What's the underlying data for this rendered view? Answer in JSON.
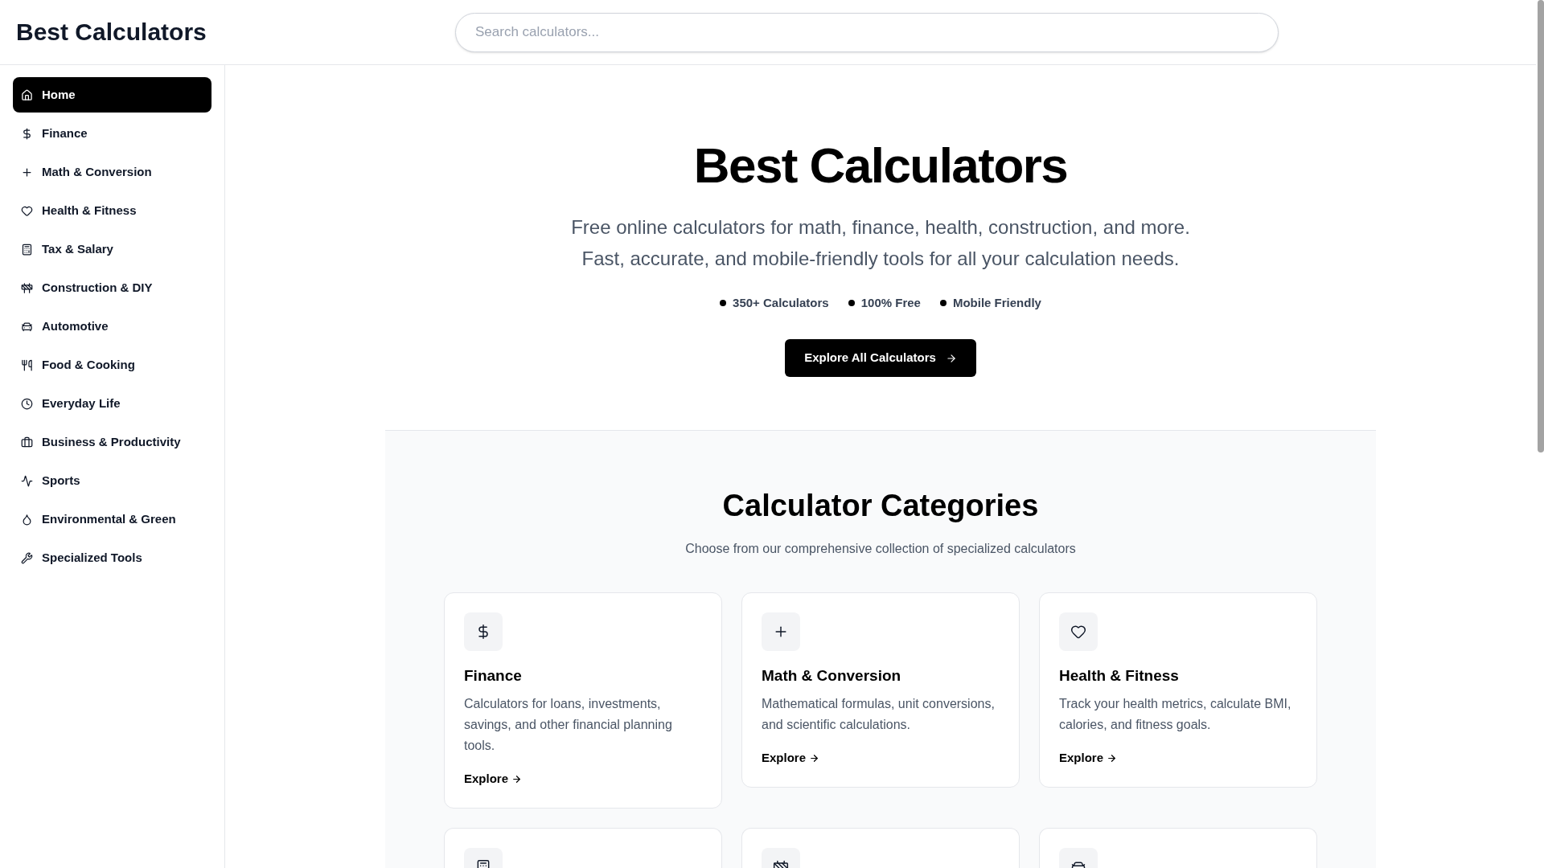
{
  "header": {
    "logo": "Best Calculators",
    "search": {
      "placeholder": "Search calculators..."
    }
  },
  "sidebar": {
    "items": [
      {
        "label": "Home",
        "selected": true
      },
      {
        "label": "Finance",
        "selected": false
      },
      {
        "label": "Math & Conversion",
        "selected": false
      },
      {
        "label": "Health & Fitness",
        "selected": false
      },
      {
        "label": "Tax & Salary",
        "selected": false
      },
      {
        "label": "Construction & DIY",
        "selected": false
      },
      {
        "label": "Automotive",
        "selected": false
      },
      {
        "label": "Food & Cooking",
        "selected": false
      },
      {
        "label": "Everyday Life",
        "selected": false
      },
      {
        "label": "Business & Productivity",
        "selected": false
      },
      {
        "label": "Sports",
        "selected": false
      },
      {
        "label": "Environmental & Green",
        "selected": false
      },
      {
        "label": "Specialized Tools",
        "selected": false
      }
    ]
  },
  "hero": {
    "title": "Best Calculators",
    "subtitle": "Free online calculators for math, finance, health, construction, and more. Fast, accurate, and mobile-friendly tools for all your calculation needs.",
    "highlights": [
      "350+ Calculators",
      "100% Free",
      "Mobile Friendly"
    ],
    "button": "Explore All Calculators"
  },
  "categories": {
    "title": "Calculator Categories",
    "subtitle": "Choose from our comprehensive collection of specialized calculators",
    "cards": [
      {
        "title": "Finance",
        "description": "Calculators for loans, investments, savings, and other financial planning tools.",
        "link": "Explore"
      },
      {
        "title": "Math & Conversion",
        "description": "Mathematical formulas, unit conversions, and scientific calculations.",
        "link": "Explore"
      },
      {
        "title": "Health & Fitness",
        "description": "Track your health metrics, calculate BMI, calories, and fitness goals.",
        "link": "Explore"
      }
    ]
  }
}
